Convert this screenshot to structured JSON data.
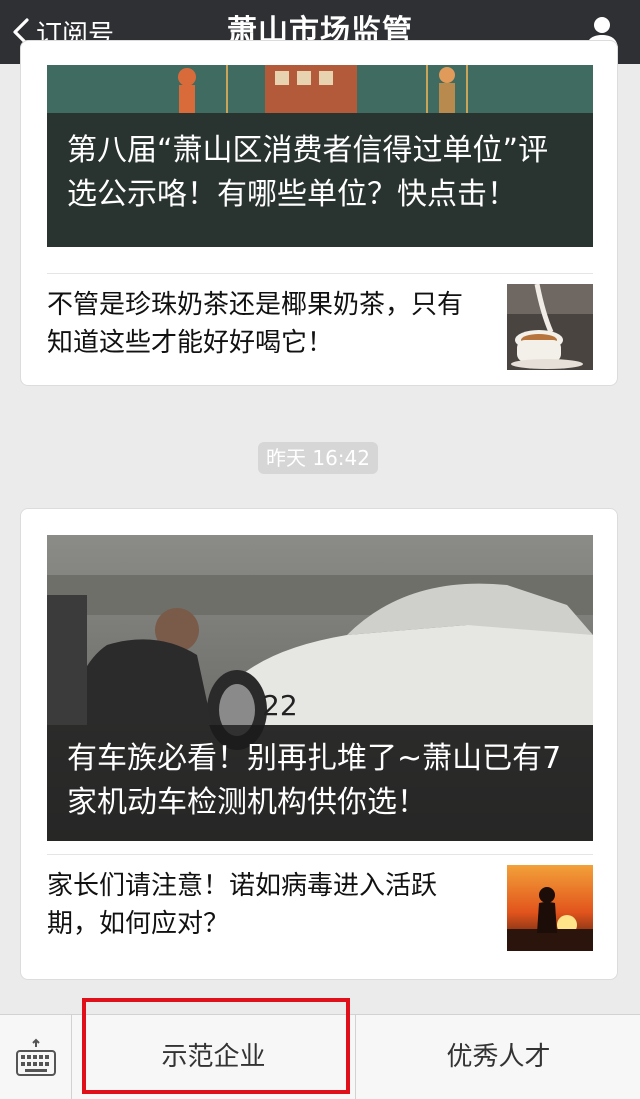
{
  "header": {
    "back_label": "订阅号",
    "title": "萧山市场监管",
    "icons": {
      "back": "chevron-left-icon",
      "profile": "person-icon"
    }
  },
  "messages": [
    {
      "cover_title": "第八届“萧山区消费者信得过单位”评选公示咯！有哪些单位？快点击！",
      "sub_item": {
        "title": "不管是珍珠奶茶还是椰果奶茶，只有知道这些才能好好喝它！"
      }
    },
    {
      "timestamp": "昨天 16:42",
      "cover_title": "有车族必看！别再扎堆了~萧山已有7家机动车检测机构供你选！",
      "sub_item": {
        "title": "家长们请注意！诺如病毒进入活跃期，如何应对？"
      }
    }
  ],
  "bottom_menu": {
    "keyboard_icon": "keyboard-icon",
    "items": [
      "示范企业",
      "优秀人才"
    ],
    "highlight_color": "#e0101a"
  },
  "colors": {
    "header_bg": "#2f3034",
    "page_bg": "#ebebeb"
  }
}
